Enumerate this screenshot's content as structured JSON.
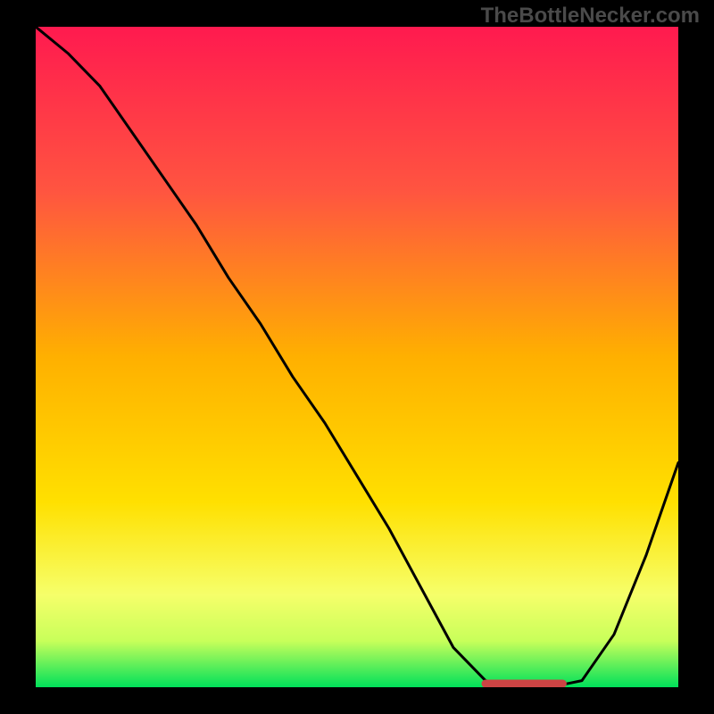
{
  "watermark": "TheBottleNecker.com",
  "chart_data": {
    "type": "line",
    "title": "",
    "xlabel": "",
    "ylabel": "",
    "xlim": [
      0,
      100
    ],
    "ylim": [
      0,
      100
    ],
    "series": [
      {
        "name": "bottleneck-curve",
        "x": [
          0,
          5,
          10,
          15,
          20,
          25,
          30,
          35,
          40,
          45,
          50,
          55,
          60,
          65,
          70,
          75,
          80,
          85,
          90,
          95,
          100
        ],
        "values": [
          100,
          96,
          91,
          84,
          77,
          70,
          62,
          55,
          47,
          40,
          32,
          24,
          15,
          6,
          1,
          0,
          0,
          1,
          8,
          20,
          34
        ]
      }
    ],
    "highlight": {
      "name": "optimal-range",
      "x_start": 70,
      "x_end": 82,
      "y": 0
    },
    "gradient_stops": [
      {
        "offset": 0.0,
        "color": "#ff1a4f"
      },
      {
        "offset": 0.25,
        "color": "#ff5540"
      },
      {
        "offset": 0.5,
        "color": "#ffb000"
      },
      {
        "offset": 0.72,
        "color": "#ffe000"
      },
      {
        "offset": 0.86,
        "color": "#f6ff6a"
      },
      {
        "offset": 0.93,
        "color": "#c8ff5a"
      },
      {
        "offset": 1.0,
        "color": "#00e05a"
      }
    ]
  }
}
